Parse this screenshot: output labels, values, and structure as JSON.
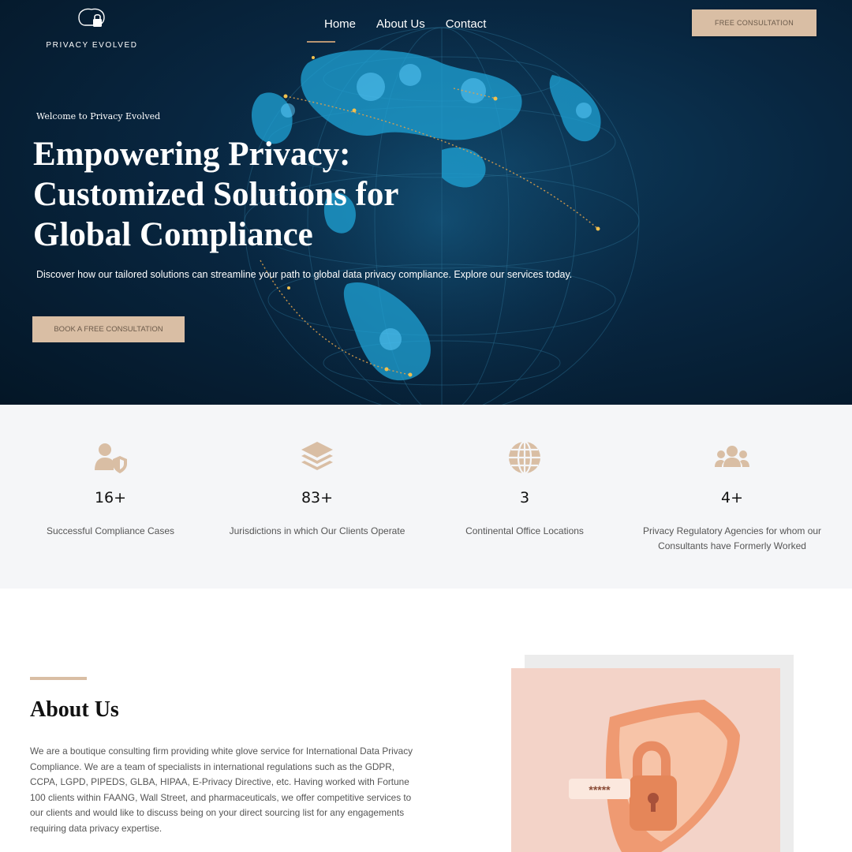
{
  "brand": {
    "name": "PRIVACY EVOLVED"
  },
  "nav": {
    "items": [
      "Home",
      "About Us",
      "Contact"
    ],
    "cta": "FREE CONSULTATION"
  },
  "hero": {
    "eyebrow": "Welcome to Privacy Evolved",
    "title_lines": [
      "Empowering Privacy:",
      "Customized Solutions for",
      "Global Compliance"
    ],
    "description": "Discover how our tailored solutions can streamline your path to global data privacy compliance. Explore our services today.",
    "button": "BOOK A FREE CONSULTATION"
  },
  "stats": [
    {
      "icon": "user-shield-icon",
      "value": "16+",
      "label": "Successful Compliance Cases"
    },
    {
      "icon": "layers-icon",
      "value": "83+",
      "label": "Jurisdictions in which Our Clients Operate"
    },
    {
      "icon": "globe-icon",
      "value": "3",
      "label": "Continental Office Locations"
    },
    {
      "icon": "users-group-icon",
      "value": "4+",
      "label": "Privacy Regulatory Agencies for whom our Consultants have Formerly Worked"
    }
  ],
  "about": {
    "title": "About Us",
    "text": "We are a boutique consulting firm providing white glove service for International Data Privacy Compliance. We are a team of specialists in international regulations such as the GDPR, CCPA, LGPD, PIPEDS, GLBA, HIPAA, E-Privacy Directive, etc. Having worked with Fortune 100 clients within FAANG, Wall Street, and pharmaceuticals, we offer competitive services to our clients and would like to discuss being on your direct sourcing list for any engagements requiring data privacy expertise.",
    "image_badge": "*****"
  },
  "colors": {
    "accent": "#d9bea4",
    "hero_bg": "#082640",
    "stats_bg": "#f5f6f8",
    "globe": "#1fa3d6"
  }
}
